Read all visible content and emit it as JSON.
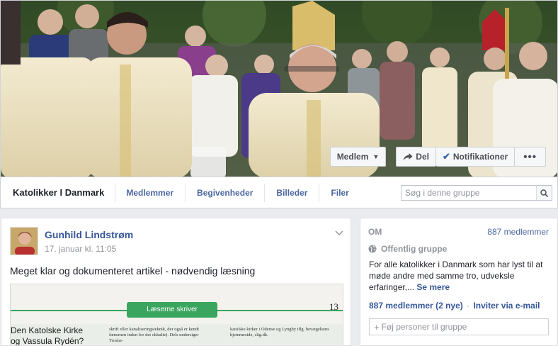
{
  "cover": {
    "member_button": "Medlem",
    "share_button": "Del",
    "notifications_button": "Notifikationer",
    "more_button": "•••"
  },
  "nav": {
    "group_name": "Katolikker I Danmark",
    "items": [
      "Medlemmer",
      "Begivenheder",
      "Billeder",
      "Filer"
    ],
    "search_placeholder": "Søg i denne gruppe"
  },
  "post": {
    "author": "Gunhild Lindstrøm",
    "timestamp": "17. januar kl. 11:05",
    "text": "Meget klar og dokumenteret artikel - nødvendig læsning",
    "attachment": {
      "banner": "Læserne skriver",
      "page_number": "13",
      "headline_1": "Den Katolske Kirke",
      "headline_2": "og Vassula Rydén?",
      "col1": "skrift eller kanaliseringsteknik, der også er kendt fænomen inden for det okkulte). Dels undersiger Troslæ-",
      "col2": "katolske kirker i Odense og Lyngby iflg. hevægelsens hjemmeside, slig.dk."
    }
  },
  "about": {
    "label": "OM",
    "member_count": "887 medlemmer",
    "group_type": "Offentlig gruppe",
    "description": "For alle katolikker i Danmark som har lyst til at møde andre med samme tro, udveksle erfaringer,...",
    "see_more": "Se mere",
    "members_link": "887 medlemmer",
    "new_count": "(2 nye)",
    "invite_link": "Inviter via e-mail",
    "add_placeholder": "Føj personer til gruppe"
  },
  "colors": {
    "link": "#365899",
    "nav_link": "#4b67a1",
    "accent_green": "#3aa55f",
    "muted": "#90949c"
  }
}
